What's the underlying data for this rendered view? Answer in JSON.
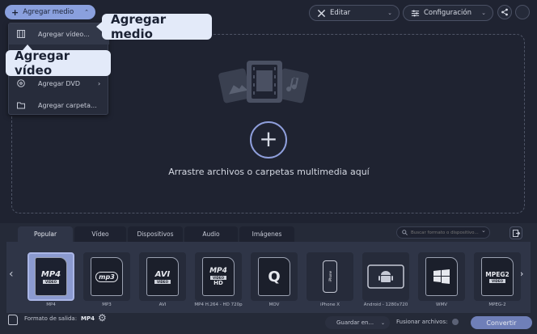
{
  "toolbar": {
    "add_media_label": "Agregar medio",
    "edit_label": "Editar",
    "settings_label": "Configuración"
  },
  "add_menu": {
    "items": [
      {
        "label": "Agregar vídeo..."
      },
      {
        "label": ""
      },
      {
        "label": "Agregar DVD"
      },
      {
        "label": "Agregar carpeta..."
      }
    ]
  },
  "callouts": {
    "add_media": "Agregar medio",
    "add_video": "Agregar vídeo"
  },
  "dropzone": {
    "hint": "Arrastre archivos o carpetas multimedia aquí"
  },
  "format_tabs": [
    {
      "label": "Popular",
      "active": true
    },
    {
      "label": "Vídeo"
    },
    {
      "label": "Dispositivos"
    },
    {
      "label": "Audio"
    },
    {
      "label": "Imágenes"
    }
  ],
  "format_search": {
    "placeholder": "Buscar formato o dispositivo..."
  },
  "formats": [
    {
      "label": "MP4",
      "badge": "MP4",
      "selected": true
    },
    {
      "label": "MP3",
      "badge": "mp3"
    },
    {
      "label": "AVI",
      "badge": "AVI"
    },
    {
      "label": "MP4 H.264 - HD 720p",
      "badge": "MP4",
      "badge2": "HD"
    },
    {
      "label": "MOV",
      "badge": "Q"
    },
    {
      "label": "iPhone X",
      "badge": "iPhone"
    },
    {
      "label": "Android - 1280x720",
      "badge": "android"
    },
    {
      "label": "WMV",
      "badge": "windows"
    },
    {
      "label": "MPEG-2",
      "badge": "MPEG2"
    }
  ],
  "footer": {
    "output_format_label": "Formato de salida:",
    "output_format_value": "MP4",
    "save_label": "Guardar en...",
    "merge_label": "Fusionar archivos:",
    "convert_label": "Convertir"
  },
  "colors": {
    "background": "#1f2331",
    "panel": "#252a38",
    "accent": "#7f8fd0",
    "callout_bg": "#e3eaf9"
  }
}
